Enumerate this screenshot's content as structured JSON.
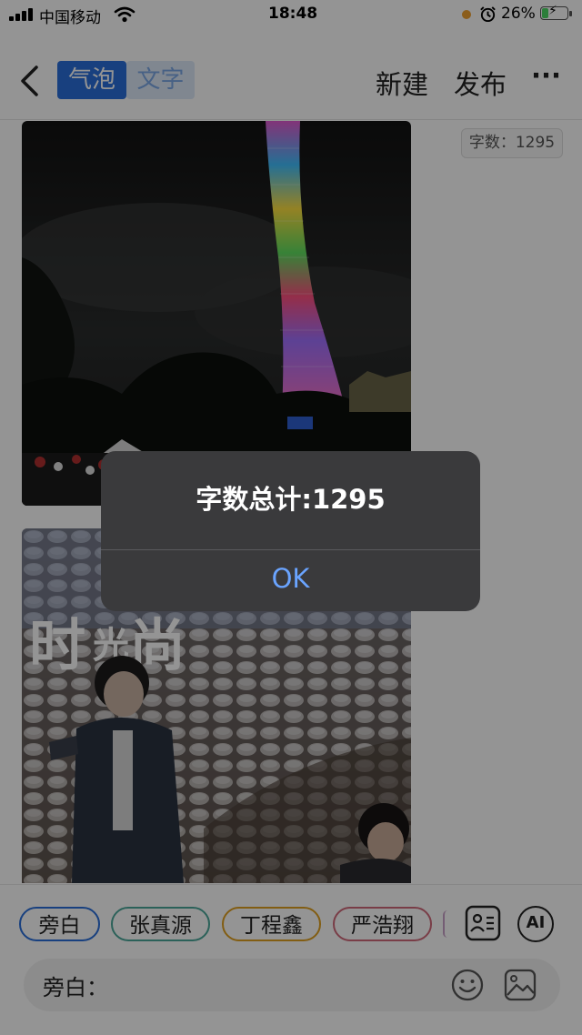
{
  "status_bar": {
    "carrier": "中国移动",
    "time": "18:48",
    "battery_percent": "26%",
    "battery_level": 0.26
  },
  "nav": {
    "segments": [
      {
        "label": "气泡",
        "active": true
      },
      {
        "label": "文字",
        "active": false
      }
    ],
    "new_label": "新建",
    "publish_label": "发布",
    "more_label": "···"
  },
  "word_count_badge": "字数：1295",
  "characters": [
    "旁白",
    "张真源",
    "丁程鑫",
    "严浩翔"
  ],
  "input": {
    "prefix": "旁白："
  },
  "ai_label": "AI",
  "alert": {
    "message": "字数总计:1295",
    "ok_label": "OK"
  },
  "colors": {
    "accent_blue": "#2a6fdb",
    "chip_green": "#4aa89a",
    "chip_orange": "#e0a020",
    "chip_pink": "#d06a7a",
    "dialog_bg": "#3a3a3c",
    "dialog_button": "#6aa4ff"
  }
}
